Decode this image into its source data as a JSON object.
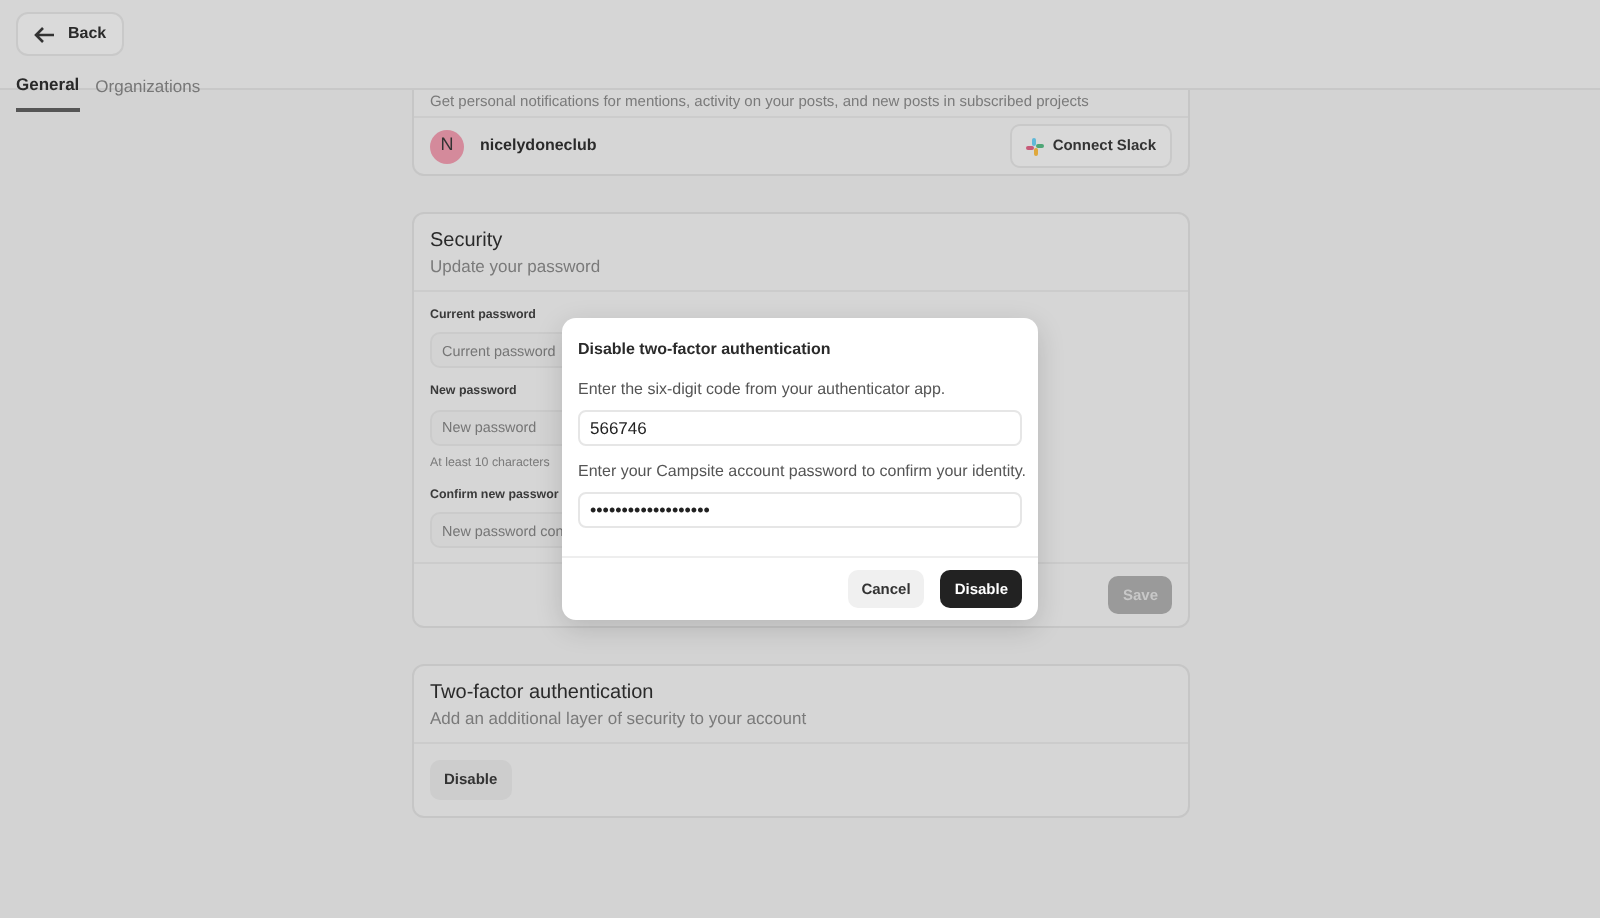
{
  "back_button": {
    "label": "Back"
  },
  "tabs": [
    {
      "label": "General",
      "selected": true
    },
    {
      "label": "Organizations",
      "selected": false
    }
  ],
  "notifications_card": {
    "description": "Get personal notifications for mentions, activity on your posts, and new posts in subscribed projects",
    "avatar_letter": "N",
    "username": "nicelydoneclub",
    "button": "Connect Slack"
  },
  "security_card": {
    "title": "Security",
    "subtitle": "Update your password",
    "fields": [
      {
        "label": "Current password",
        "placeholder": "Current password"
      },
      {
        "label": "New password",
        "placeholder": "New password",
        "hint": "At least 10 characters"
      },
      {
        "label": "Confirm new passwor",
        "placeholder": "New password con"
      }
    ],
    "save_button": {
      "label": "Save",
      "disabled": true
    }
  },
  "two_factor_card": {
    "title": "Two-factor authentication",
    "subtitle": "Add an additional layer of security to your account",
    "button": "Disable"
  },
  "dialog": {
    "title": "Disable two-factor authentication",
    "code_prompt": "Enter the six-digit code from your authenticator app.",
    "code_value": "566746",
    "password_prompt": "Enter your Campsite account password to confirm your identity.",
    "password_value": "•••••••••••••••••••",
    "cancel": "Cancel",
    "confirm": "Disable"
  }
}
